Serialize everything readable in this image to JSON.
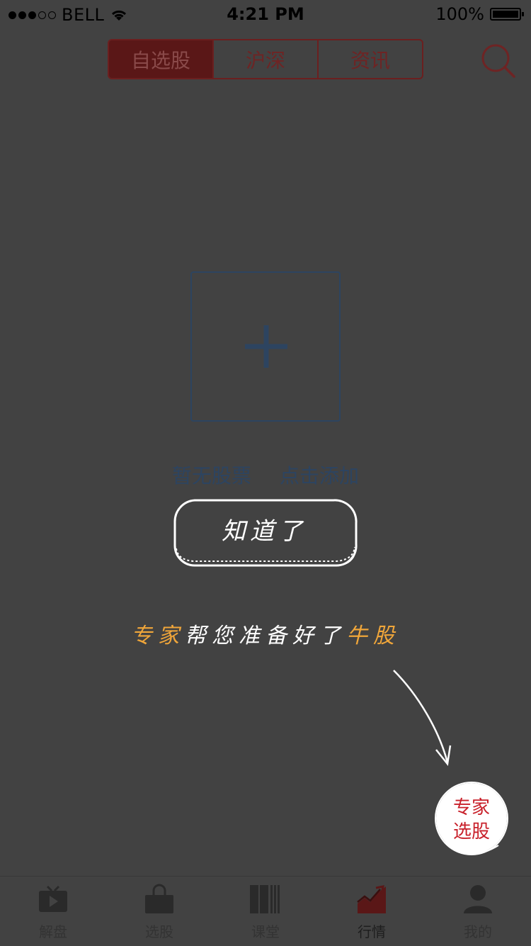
{
  "status_bar": {
    "carrier": "BELL",
    "time": "4:21 PM",
    "battery": "100%"
  },
  "tabs": [
    {
      "label": "自选股",
      "active": true
    },
    {
      "label": "沪深",
      "active": false
    },
    {
      "label": "资讯",
      "active": false
    }
  ],
  "empty_state": {
    "no_stocks": "暂无股票",
    "add_hint": "点击添加"
  },
  "guide": {
    "got_it": "知道了",
    "tip_parts": [
      {
        "text": "专家",
        "highlight": true
      },
      {
        "text": "帮您准备好了",
        "highlight": false
      },
      {
        "text": "牛股",
        "highlight": true
      }
    ]
  },
  "fab": {
    "line1": "专家",
    "line2": "选股"
  },
  "tabbar": [
    {
      "label": "解盘",
      "icon": "tv-play-icon"
    },
    {
      "label": "选股",
      "icon": "bag-icon"
    },
    {
      "label": "课堂",
      "icon": "books-icon"
    },
    {
      "label": "行情",
      "icon": "chart-trend-icon",
      "active": true
    },
    {
      "label": "我的",
      "icon": "person-icon"
    }
  ],
  "colors": {
    "accent": "#c8202a",
    "highlight": "#f0a63a",
    "overlay": "#424242"
  }
}
